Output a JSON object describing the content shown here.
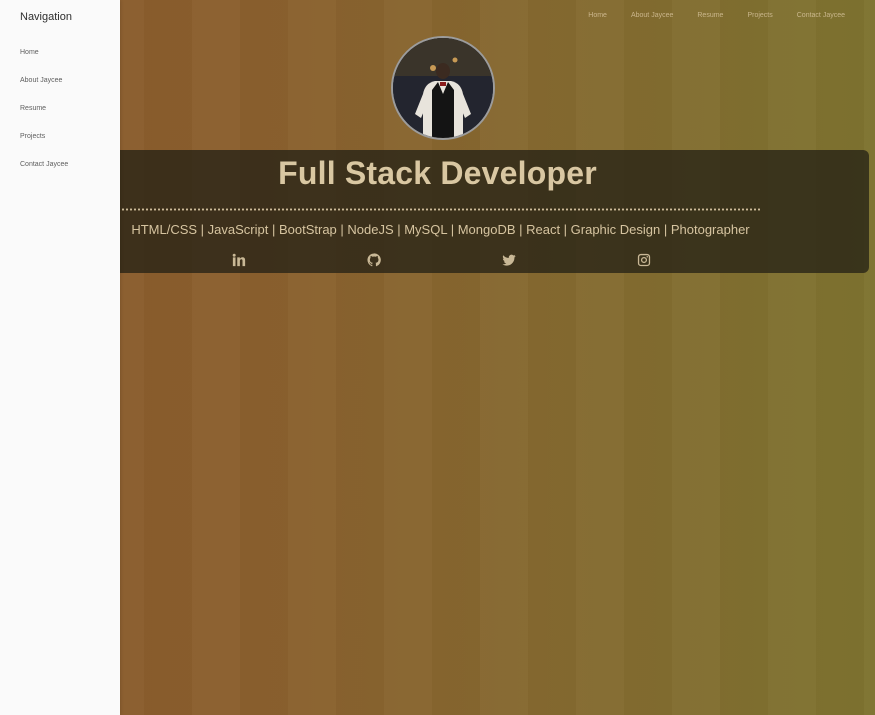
{
  "topnav": {
    "brand": "",
    "links": [
      "Home",
      "About Jaycee",
      "Resume",
      "Projects",
      "Contact Jaycee"
    ]
  },
  "hero": {
    "title": "Full Stack Developer",
    "skills": "HTML/CSS | JavaScript | BootStrap | NodeJS | MySQL | MongoDB | React | Graphic Design | Photographer",
    "socials": [
      "linkedin-icon",
      "github-icon",
      "twitter-icon",
      "instagram-icon"
    ]
  },
  "drawer": {
    "title": "Navigation",
    "items": [
      "Home",
      "About Jaycee",
      "Resume",
      "Projects",
      "Contact Jaycee"
    ]
  },
  "colors": {
    "drawer_bg": "#fafafa",
    "hero_bg": "#262216",
    "text_accent": "#d9c7a2"
  }
}
